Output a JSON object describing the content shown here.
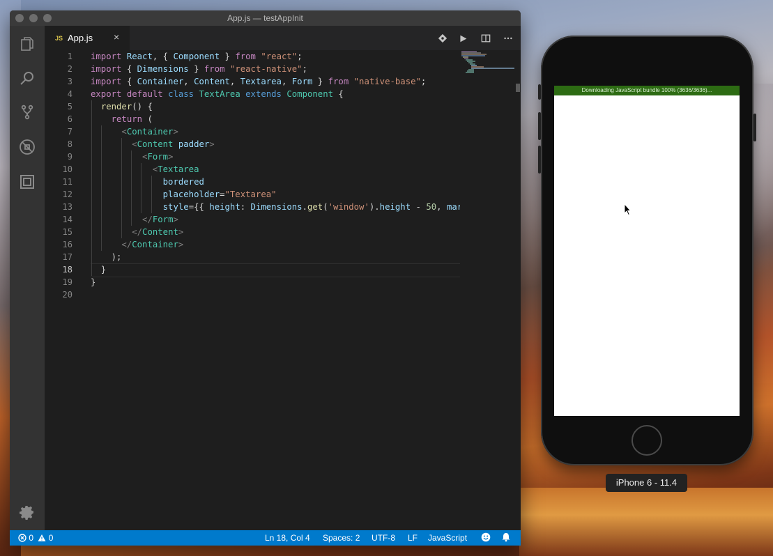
{
  "window": {
    "title": "App.js — testAppInit"
  },
  "tab": {
    "icon_label": "JS",
    "filename": "App.js",
    "close": "×"
  },
  "editor": {
    "line_numbers": [
      "1",
      "2",
      "3",
      "4",
      "5",
      "6",
      "7",
      "8",
      "9",
      "10",
      "11",
      "12",
      "13",
      "14",
      "15",
      "16",
      "17",
      "18",
      "19",
      "20"
    ],
    "active_line": 18
  },
  "statusbar": {
    "errors": "0",
    "warnings": "0",
    "position": "Ln 18, Col 4",
    "spaces": "Spaces: 2",
    "encoding": "UTF-8",
    "eol": "LF",
    "language": "JavaScript"
  },
  "simulator": {
    "download_banner": "Downloading JavaScript bundle 100% (3636/3636)...",
    "device_label": "iPhone 6 - 11.4"
  },
  "colors": {
    "accent": "#007acc",
    "banner_green": "#2d6b13"
  }
}
